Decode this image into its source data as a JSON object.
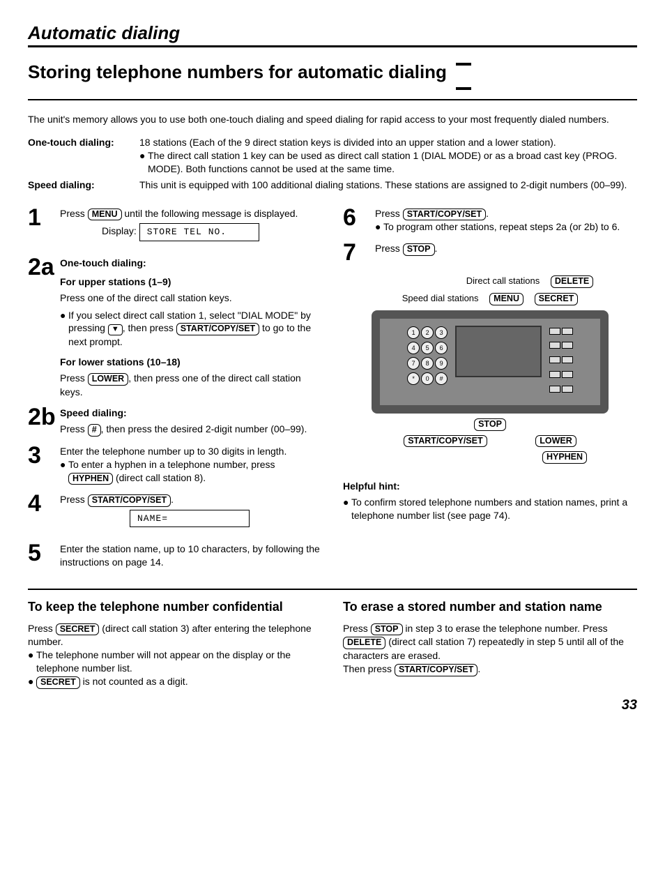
{
  "section": "Automatic dialing",
  "title": "Storing telephone numbers for automatic dialing",
  "intro": "The unit's memory allows you to use both one-touch dialing and speed dialing for rapid access to your most frequently dialed numbers.",
  "defs": {
    "onetouch_label": "One-touch dialing:",
    "onetouch_body": "18 stations (Each of the 9 direct station keys is divided into an upper station and a lower station).",
    "onetouch_bullet": "The direct call station 1 key can be used as direct call station 1 (DIAL MODE) or as a broad cast key (PROG. MODE). Both functions cannot be used at the same time.",
    "speed_label": "Speed dialing:",
    "speed_body": "This unit is equipped with 100 additional dialing stations. These stations are assigned to 2-digit numbers (00–99)."
  },
  "keys": {
    "menu": "MENU",
    "start": "START/COPY/SET",
    "stop": "STOP",
    "lower": "LOWER",
    "hyphen": "HYPHEN",
    "secret": "SECRET",
    "delete": "DELETE",
    "hash": "#",
    "down": "▼"
  },
  "steps": {
    "s1_pre": "Press ",
    "s1_post": " until the following message is displayed.",
    "display_label": "Display:",
    "display1": "STORE TEL NO.",
    "s2a_num": "2a",
    "s2a_title": "One-touch dialing:",
    "s2a_upper_title": "For upper stations (1–9)",
    "s2a_upper_body": "Press one of the direct call station keys.",
    "s2a_bullet_pre": "If you select direct call station 1, select \"DIAL MODE\" by pressing ",
    "s2a_bullet_mid": ", then press ",
    "s2a_bullet_post": " to go to the next prompt.",
    "s2a_lower_title": "For lower stations (10–18)",
    "s2a_lower_pre": "Press ",
    "s2a_lower_post": ", then press one of the direct call station keys.",
    "s2b_num": "2b",
    "s2b_title": "Speed dialing:",
    "s2b_pre": "Press ",
    "s2b_post": ", then press the desired 2-digit number (00–99).",
    "s3_body": "Enter the telephone number up to 30 digits in length.",
    "s3_bullet_pre": "To enter a hyphen in a telephone number, press ",
    "s3_bullet_post": " (direct call station 8).",
    "s4_pre": "Press ",
    "s4_post": ".",
    "display2": "NAME=",
    "s5_body": "Enter the station name, up to 10 characters, by following the instructions on page 14.",
    "s6_pre": "Press ",
    "s6_post": ".",
    "s6_bullet": "To program other stations, repeat steps 2a (or 2b) to 6.",
    "s7_pre": "Press ",
    "s7_post": "."
  },
  "diagram": {
    "direct_call": "Direct call stations",
    "speed_dial": "Speed dial stations"
  },
  "hint_title": "Helpful hint:",
  "hint_body": "To confirm stored telephone numbers and station names, print a telephone number list (see page 74).",
  "bottom": {
    "left_title": "To keep the telephone number confidential",
    "left_p1_pre": "Press ",
    "left_p1_post": " (direct call station 3) after entering the telephone number.",
    "left_b1": "The telephone number will not appear on the display or the telephone number list.",
    "left_b2_post": " is not counted as a digit.",
    "right_title": "To erase a stored number and station name",
    "right_p_pre": "Press ",
    "right_p_mid1": " in step 3 to erase the telephone number. Press ",
    "right_p_mid2": " (direct call station 7) repeatedly in step 5 until all of the characters are erased.",
    "right_p_then": "Then press ",
    "right_p_end": "."
  },
  "page_number": "33"
}
